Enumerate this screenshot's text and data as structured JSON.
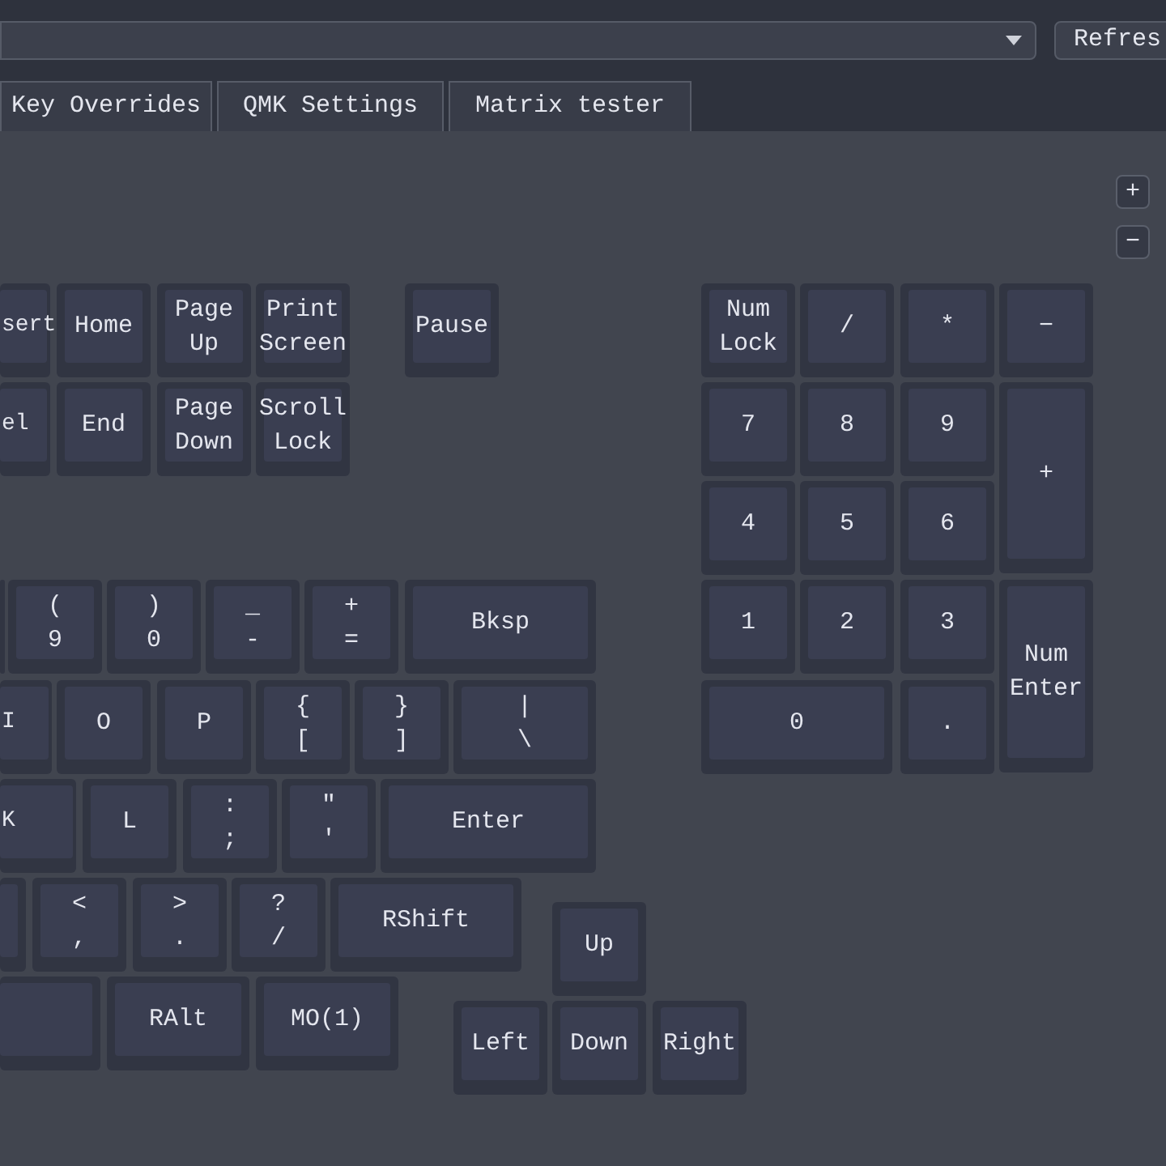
{
  "toolbar": {
    "refresh_button": "Refres"
  },
  "tabs": [
    {
      "label": "Key Overrides"
    },
    {
      "label": "QMK Settings"
    },
    {
      "label": "Matrix tester"
    }
  ],
  "zoom_buttons": [
    "+",
    "−"
  ],
  "keys": [
    {
      "label": "sert"
    },
    {
      "label": "Home"
    },
    {
      "label": "Page\nUp"
    },
    {
      "label": "Print\nScreen"
    },
    {
      "label": "Pause"
    },
    {
      "label": "Num\nLock"
    },
    {
      "label": "/"
    },
    {
      "label": "*"
    },
    {
      "label": "−"
    },
    {
      "label": "el"
    },
    {
      "label": "End"
    },
    {
      "label": "Page\nDown"
    },
    {
      "label": "Scroll\nLock"
    },
    {
      "label": "7"
    },
    {
      "label": "8"
    },
    {
      "label": "9"
    },
    {
      "label": "+"
    },
    {
      "label": "4"
    },
    {
      "label": "5"
    },
    {
      "label": "6"
    },
    {
      "label": "(\n9"
    },
    {
      "label": ")\n0"
    },
    {
      "label": "_\n-"
    },
    {
      "label": "+\n="
    },
    {
      "label": "Bksp"
    },
    {
      "label": "1"
    },
    {
      "label": "2"
    },
    {
      "label": "3"
    },
    {
      "label": "Num\nEnter"
    },
    {
      "label": "I"
    },
    {
      "label": "O"
    },
    {
      "label": "P"
    },
    {
      "label": "{\n["
    },
    {
      "label": "}\n]"
    },
    {
      "label": "|\n\\"
    },
    {
      "label": "0"
    },
    {
      "label": "."
    },
    {
      "label": "K"
    },
    {
      "label": "L"
    },
    {
      "label": ":\n;"
    },
    {
      "label": "\"\n'"
    },
    {
      "label": "Enter"
    },
    {
      "label": "<\n,"
    },
    {
      "label": ">\n."
    },
    {
      "label": "?\n/"
    },
    {
      "label": "RShift"
    },
    {
      "label": "Up"
    },
    {
      "label": "RAlt"
    },
    {
      "label": "MO(1)"
    },
    {
      "label": "Left"
    },
    {
      "label": "Down"
    },
    {
      "label": "Right"
    }
  ]
}
